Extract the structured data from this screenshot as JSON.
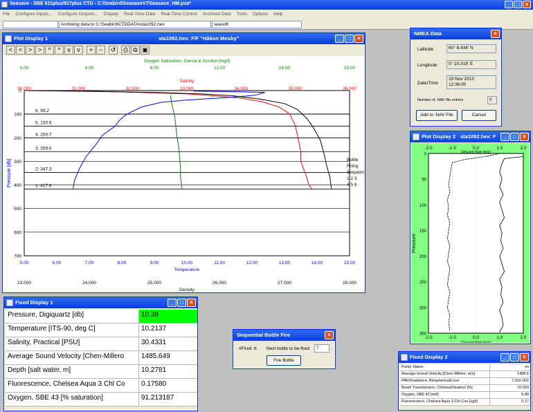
{
  "app": {
    "title": "Seasave - SBE 911plus/917plus CTD - C:\\Seabird\\SeasaveV7\\Seasave_HM.psa*"
  },
  "menu": [
    "File",
    "Configure Inputs...",
    "Configure Outputs...",
    "Display",
    "Real-Time Data",
    "Real-Time Control",
    "Archived Data",
    "Tools",
    "Options",
    "Help"
  ],
  "status": {
    "archive": "Archiving data to C:\\Seabird\\CTDDATA\\sta1092.hex",
    "port": "seasoft"
  },
  "plot1": {
    "title": "Plot Display 1",
    "subtitle": "sta1092.hex: F/F \"Håkon Mosby\"",
    "toolbar": [
      "<",
      "<",
      ">",
      ">",
      "^",
      "^",
      "v",
      "v",
      "+",
      "−",
      "↺",
      "⎙",
      "⧉",
      "▣"
    ],
    "axes": {
      "oxygen": {
        "label": "Oxygen Saturation, Garcia & Gordon [mg/l]",
        "ticks": [
          "0.00",
          "4.00",
          "8.00",
          "12.00",
          "16.00",
          "20.00"
        ],
        "color": "#008000"
      },
      "salinity": {
        "label": "Salinity",
        "ticks": [
          "30.000",
          "31.000",
          "32.000",
          "33.000",
          "34.000",
          "35.000",
          "36.000"
        ],
        "color": "#ff0000"
      },
      "temperature": {
        "label": "Temperature",
        "ticks": [
          "5.00",
          "6.00",
          "7.00",
          "8.00",
          "9.00",
          "10.00",
          "11.00",
          "12.00",
          "13.00",
          "14.00",
          "15.00"
        ],
        "color": "#0000ff"
      },
      "density": {
        "label": "Density",
        "ticks": [
          "23.000",
          "24.000",
          "25.000",
          "26.000",
          "27.000",
          "28.000"
        ],
        "color": "#000000"
      },
      "pressure": {
        "label": "Pressure [db]",
        "ticks": [
          "0",
          "100",
          "200",
          "300",
          "400",
          "500",
          "600",
          "700"
        ],
        "range": [
          0,
          700
        ]
      }
    },
    "bottles": [
      {
        "label": "6, 99.2",
        "p": 99.2
      },
      {
        "label": "5, 150.6",
        "p": 150.6
      },
      {
        "label": "4, 200.7",
        "p": 200.7
      },
      {
        "label": "3, 259.6",
        "p": 259.6
      },
      {
        "label": "2, 347.3",
        "p": 347.3
      },
      {
        "label": "1, 417.6",
        "p": 417.6
      }
    ],
    "legend": {
      "l1": "Bottle",
      "l2": "Firing",
      "l3": "Sequence",
      "l4": "1  2  3",
      "l5": "4  5  6"
    },
    "chart_data": {
      "type": "line",
      "ylim": [
        0,
        700
      ],
      "series": [
        {
          "name": "Salinity",
          "axis": "salinity",
          "xlim": [
            30,
            36
          ],
          "color": "#ff0000",
          "points": [
            [
              30.0,
              0
            ],
            [
              31.2,
              3
            ],
            [
              31.8,
              6
            ],
            [
              32.4,
              10
            ],
            [
              33.0,
              14
            ],
            [
              33.5,
              22
            ],
            [
              34.0,
              32
            ],
            [
              34.4,
              48
            ],
            [
              34.7,
              70
            ],
            [
              34.9,
              100
            ],
            [
              35.0,
              150
            ],
            [
              35.05,
              200
            ],
            [
              35.1,
              260
            ],
            [
              35.1,
              300
            ],
            [
              35.2,
              360
            ],
            [
              35.25,
              400
            ],
            [
              35.3,
              415
            ]
          ]
        },
        {
          "name": "Temperature",
          "axis": "temperature",
          "xlim": [
            5,
            15
          ],
          "color": "#0000ff",
          "points": [
            [
              10.2,
              2
            ],
            [
              11.5,
              5
            ],
            [
              12.4,
              8
            ],
            [
              12.1,
              20
            ],
            [
              11.2,
              30
            ],
            [
              10.0,
              40
            ],
            [
              9.2,
              50
            ],
            [
              8.6,
              70
            ],
            [
              8.3,
              90
            ],
            [
              8.1,
              105
            ],
            [
              7.9,
              130
            ],
            [
              7.8,
              150
            ],
            [
              7.4,
              190
            ],
            [
              7.2,
              230
            ],
            [
              6.9,
              280
            ],
            [
              6.7,
              330
            ],
            [
              6.55,
              380
            ],
            [
              6.5,
              415
            ]
          ]
        },
        {
          "name": "Oxygen Saturation, Garcia & Gordon [mg/l]",
          "axis": "oxygen",
          "xlim": [
            0,
            20
          ],
          "color": "#008000",
          "points": [
            [
              9.0,
              20
            ],
            [
              9.05,
              50
            ],
            [
              9.15,
              80
            ],
            [
              9.25,
              110
            ],
            [
              9.3,
              140
            ],
            [
              9.35,
              170
            ],
            [
              9.4,
              200
            ],
            [
              9.5,
              240
            ],
            [
              9.55,
              280
            ],
            [
              9.6,
              320
            ],
            [
              9.6,
              360
            ],
            [
              9.65,
              390
            ],
            [
              9.7,
              415
            ]
          ]
        },
        {
          "name": "Density",
          "axis": "density",
          "xlim": [
            23,
            28
          ],
          "color": "#000000",
          "points": [
            [
              23.0,
              0
            ],
            [
              24.2,
              4
            ],
            [
              25.0,
              8
            ],
            [
              25.7,
              14
            ],
            [
              26.2,
              22
            ],
            [
              26.6,
              35
            ],
            [
              27.0,
              55
            ],
            [
              27.2,
              80
            ],
            [
              27.35,
              120
            ],
            [
              27.45,
              160
            ],
            [
              27.55,
              210
            ],
            [
              27.6,
              260
            ],
            [
              27.65,
              320
            ],
            [
              27.7,
              370
            ],
            [
              27.72,
              415
            ]
          ]
        }
      ]
    }
  },
  "nmea": {
    "title": "NMEA Data",
    "lat_label": "Latitude",
    "lat": "60°  8.434' N",
    "lon_label": "Longitude",
    "lon": "5°  10.318' E",
    "dt_label": "Date/Time",
    "date": "19 Nov 2013",
    "time": "12:36:00",
    "nav_label": "Number of .NAV file entries",
    "nav": "0",
    "add_btn": "Add to .NAV File",
    "cancel_btn": "Cancel"
  },
  "plot2": {
    "title": "Plot Display 2",
    "subtitle": "sta1092.hex: F",
    "xlabel": "Descent Rate [m/s]",
    "ylabel": "Pressure",
    "xticks": [
      "-2.0",
      "-1.0",
      "0.0",
      "1.0",
      "2.0"
    ],
    "yticks": [
      "0",
      "50",
      "100",
      "150",
      "200",
      "250",
      "300",
      "350"
    ],
    "chart_data": {
      "type": "line",
      "xlim": [
        -2,
        2
      ],
      "ylim": [
        0,
        350
      ],
      "series": [
        {
          "name": "Descent Rate [m/s]",
          "color": "#000000",
          "points": [
            [
              1.0,
              0
            ],
            [
              0.4,
              6
            ],
            [
              -0.5,
              12
            ],
            [
              -1.0,
              18
            ],
            [
              -1.05,
              30
            ],
            [
              -1.1,
              45
            ],
            [
              -1.15,
              60
            ],
            [
              -1.1,
              75
            ],
            [
              -1.2,
              90
            ],
            [
              -1.15,
              105
            ],
            [
              -1.2,
              120
            ],
            [
              -1.1,
              135
            ],
            [
              -1.15,
              150
            ],
            [
              -1.2,
              165
            ],
            [
              -1.1,
              180
            ],
            [
              -1.15,
              195
            ],
            [
              -1.2,
              210
            ],
            [
              -1.1,
              225
            ],
            [
              -1.15,
              240
            ],
            [
              -1.2,
              255
            ],
            [
              -1.1,
              270
            ],
            [
              -1.15,
              285
            ],
            [
              -1.2,
              300
            ],
            [
              -1.1,
              315
            ],
            [
              -1.15,
              330
            ],
            [
              -1.1,
              345
            ]
          ]
        },
        {
          "name": "Descent Rate [m/s]",
          "color": "#000000",
          "points": [
            [
              2.0,
              6
            ],
            [
              1.2,
              10
            ],
            [
              1.1,
              20
            ],
            [
              1.0,
              35
            ],
            [
              1.1,
              50
            ],
            [
              1.0,
              65
            ],
            [
              1.15,
              80
            ],
            [
              1.0,
              95
            ],
            [
              1.1,
              110
            ],
            [
              1.2,
              125
            ],
            [
              1.0,
              140
            ],
            [
              1.1,
              155
            ],
            [
              1.05,
              170
            ],
            [
              1.15,
              185
            ],
            [
              1.0,
              200
            ],
            [
              1.1,
              215
            ],
            [
              1.2,
              230
            ],
            [
              1.0,
              245
            ],
            [
              1.1,
              260
            ],
            [
              1.05,
              275
            ],
            [
              1.15,
              290
            ],
            [
              1.0,
              305
            ],
            [
              1.1,
              320
            ],
            [
              1.15,
              335
            ],
            [
              1.0,
              348
            ]
          ]
        }
      ]
    }
  },
  "fixed1": {
    "title": "Fixed Display 1",
    "rows": [
      {
        "name": "Pressure, Digiquartz [db]",
        "value": "10.38",
        "highlight": true
      },
      {
        "name": "Temperature [ITS-90, deg C]",
        "value": "10.2137"
      },
      {
        "name": "Salinity, Practical [PSU]",
        "value": "30.4331"
      },
      {
        "name": "Average Sound Velocity [Chen-Millero",
        "value": "1485.649"
      },
      {
        "name": "Depth [salt water, m]",
        "value": "10.2781"
      },
      {
        "name": "Fluorescence, Chelsea Aqua 3 Chl Co",
        "value": "0.17580"
      },
      {
        "name": "Oxygen, SBE 43 [% saturation]",
        "value": "91.213187"
      }
    ]
  },
  "bottle": {
    "title": "Sequential Bottle Fire",
    "fired_label": "#Fired: 6",
    "next_label": "Next bottle to be fired:",
    "next": "7",
    "fire_btn": "Fire Bottle"
  },
  "fixed2": {
    "title": "Fixed Display 2",
    "rows": [
      {
        "name": "Pump Status",
        "value": "on"
      },
      {
        "name": "Average Sound Velocity [Chen-Millero, m/s]",
        "value": "1485.6"
      },
      {
        "name": "PAR/Irradiance, Biospherical/Licor",
        "value": "7.02e-002"
      },
      {
        "name": "Beam Transmission, Chelsea/Seatech [%]",
        "value": "70.550"
      },
      {
        "name": "Oxygen, SBE 43 [ml/l]",
        "value": "5.89"
      },
      {
        "name": "Fluorescence, Chelsea Aqua 3 Chl Con [ug/l]",
        "value": "0.17"
      }
    ]
  }
}
